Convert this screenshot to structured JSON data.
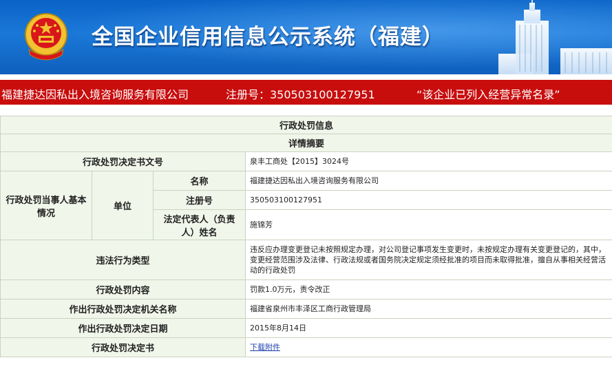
{
  "header": {
    "site_title": "全国企业信用信息公示系统（福建）",
    "emblem_icon": "national-emblem-icon",
    "building_icon": "building-illustration-icon",
    "colors": {
      "banner": "#1a78d8",
      "red_bar": "#c80d0d",
      "label_bg": "#f1f6ea"
    }
  },
  "company_bar": {
    "company_name": "福建捷达因私出入境咨询服务有限公司",
    "reg_label": "注册号：350503100127951",
    "abnormal_notice": "“该企业已列入经营异常名录”"
  },
  "penalty": {
    "section_title": "行政处罚信息",
    "summary_title": "详情摘要",
    "doc_no": {
      "label": "行政处罚决定书文号",
      "value": "泉丰工商处【2015】3024号"
    },
    "party": {
      "label": "行政处罚当事人基本情况",
      "unit_label": "单位",
      "name_label": "名称",
      "name_value": "福建捷达因私出入境咨询服务有限公司",
      "reg_no_label": "注册号",
      "reg_no_value": "350503100127951",
      "rep_label": "法定代表人（负责人）姓名",
      "rep_value": "施锦芳"
    },
    "violation": {
      "label": "违法行为类型",
      "value": "违反应办理变更登记未按照规定办理，对公司登记事项发生变更时，未按规定办理有关变更登记的，其中，变更经营范围涉及法律、行政法规或者国务院决定规定须经批准的项目而未取得批准，擅自从事相关经营活动的行政处罚"
    },
    "content": {
      "label": "行政处罚内容",
      "value": "罚款1.0万元，责令改正"
    },
    "authority": {
      "label": "作出行政处罚决定机关名称",
      "value": "福建省泉州市丰泽区工商行政管理局"
    },
    "date": {
      "label": "作出行政处罚决定日期",
      "value": "2015年8月14日"
    },
    "document": {
      "label": "行政处罚决定书",
      "link_text": "下载附件"
    }
  }
}
